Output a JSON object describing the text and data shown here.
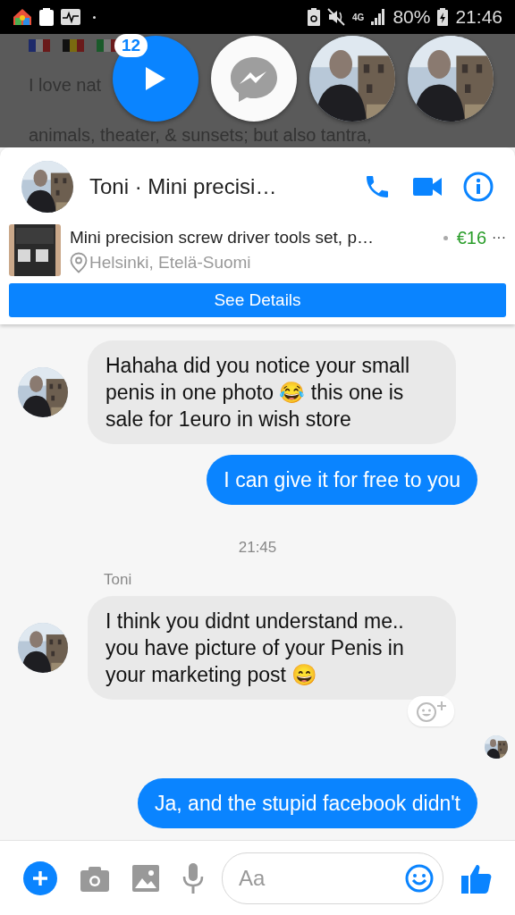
{
  "status_bar": {
    "battery": "80%",
    "time": "21:46",
    "network": "4G"
  },
  "background_page": {
    "lines": [
      "I love nat",
      "animals, theater, & sunsets; but also tantra,"
    ]
  },
  "chat_heads": {
    "badge": "12"
  },
  "conversation": {
    "title": "Toni · Mini precisi…"
  },
  "listing": {
    "title": "Mini precision screw driver tools set, p…",
    "location": "Helsinki, Etelä-Suomi",
    "price": "€16",
    "more": "···",
    "button": "See Details"
  },
  "messages": [
    {
      "kind": "incoming",
      "text": "Hahaha did you notice your small penis in one photo 😂 this one is sale for 1euro in wish store",
      "avatar": true
    },
    {
      "kind": "outgoing",
      "text": "I can give it for free to you"
    },
    {
      "kind": "time",
      "text": "21:45"
    },
    {
      "kind": "sender",
      "text": "Toni"
    },
    {
      "kind": "incoming",
      "text": "I think you didnt understand me.. you have picture of your Penis in your marketing post 😄",
      "avatar": true,
      "reaction_button": true
    },
    {
      "kind": "seen"
    },
    {
      "kind": "outgoing",
      "text": "Ja, and the stupid facebook didn't"
    }
  ],
  "composer": {
    "placeholder": "Aa"
  }
}
